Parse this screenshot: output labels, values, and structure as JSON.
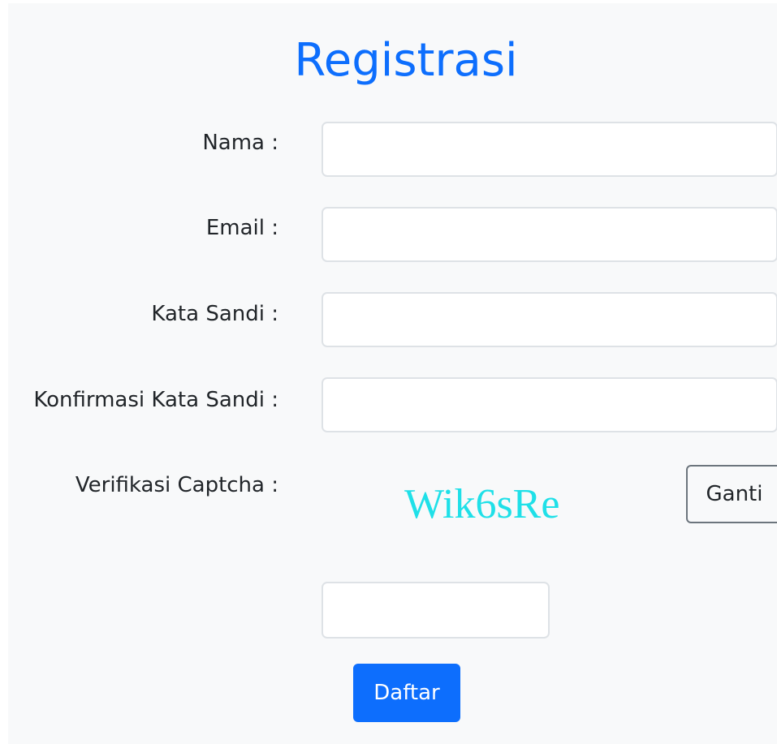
{
  "form": {
    "title": "Registrasi",
    "fields": [
      {
        "label": "Nama :",
        "value": "",
        "placeholder": ""
      },
      {
        "label": "Email :",
        "value": "",
        "placeholder": ""
      },
      {
        "label": "Kata Sandi :",
        "value": "",
        "placeholder": ""
      },
      {
        "label": "Konfirmasi Kata Sandi :",
        "value": "",
        "placeholder": ""
      }
    ],
    "captcha": {
      "label": "Verifikasi Captcha :",
      "code": "Wik6sRe",
      "change_label": "Ganti",
      "input_value": ""
    },
    "submit_label": "Daftar"
  },
  "colors": {
    "accent": "#0d6efd",
    "captcha_text": "#1fe0e8",
    "panel_background": "#f8f9fa",
    "text": "#212529"
  }
}
